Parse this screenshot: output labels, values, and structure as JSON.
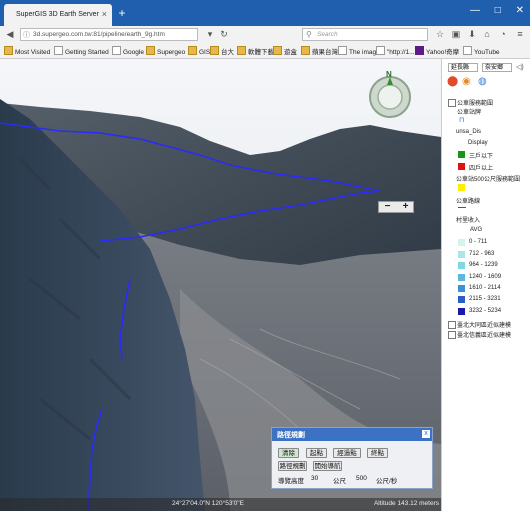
{
  "browser": {
    "tab_title": "SuperGIS 3D Earth Server",
    "tab_close": "×",
    "new_tab": "+",
    "window_controls": [
      "—",
      "□",
      "✕"
    ],
    "url": "3d.supergeo.com.tw:81/pipeline/earth_9g.htm",
    "search_placeholder": "Search",
    "bookmarks": [
      "Most Visited",
      "Getting Started",
      "Google",
      "Supergeo",
      "GIS",
      "台大",
      "軟體下載",
      "遊盒",
      "蘋果台灣",
      "The image",
      "\"http://1...",
      "Yahoo!奇摩",
      "YouTube"
    ]
  },
  "legend": {
    "select_1": "延長縣",
    "select_2": "奈安鄉",
    "layer_bus_range": "公車服務範圍",
    "bus_stop": "公車站牌",
    "unsa_dis": "unsa_Dis",
    "display": "Display",
    "three_below": "三戶以下",
    "four_above": "四戶以上",
    "bus_500": "公車站500公尺服務範圍",
    "bus_route": "公車路線",
    "village_income": "村里收入",
    "avg": "AVG",
    "classes": [
      "0 - 711",
      "712 - 963",
      "964 - 1239",
      "1240 - 1609",
      "1610 - 2114",
      "2115 - 3231",
      "3232 - 5234"
    ],
    "class_colors": [
      "#d4f3ee",
      "#a9e8e6",
      "#7ed8de",
      "#5cb8dc",
      "#3f8fd6",
      "#2a5ec8",
      "#1a1aa8"
    ],
    "layer_taipei": "臺北大同區近似建模",
    "layer_xinyi": "臺北信義區近似建模"
  },
  "panel": {
    "title": "路徑規劃",
    "close": "x",
    "btn_clear": "清除",
    "btn_start": "起點",
    "btn_via": "經過點",
    "btn_end": "終點",
    "btn_compute": "路徑規劃",
    "btn_nav": "開始導航",
    "height_label": "導覽高度",
    "height_value": "30",
    "height_unit": "公尺",
    "speed_value": "500",
    "speed_unit": "公尺/秒"
  },
  "map": {
    "compass_n": "N",
    "zoom_out": "−",
    "zoom_in": "+",
    "coords": "24°27'04.0\"N 120°53'0\"E",
    "altitude": "Altitude 143.12 meters"
  },
  "colors": {
    "title_bar": "#1f5fae",
    "route": "#2a2aff",
    "panel_header": "#3b72c4",
    "red_pin": "#e14b2b",
    "green": "#119911",
    "red": "#e11111",
    "yellow": "#ffee00"
  }
}
